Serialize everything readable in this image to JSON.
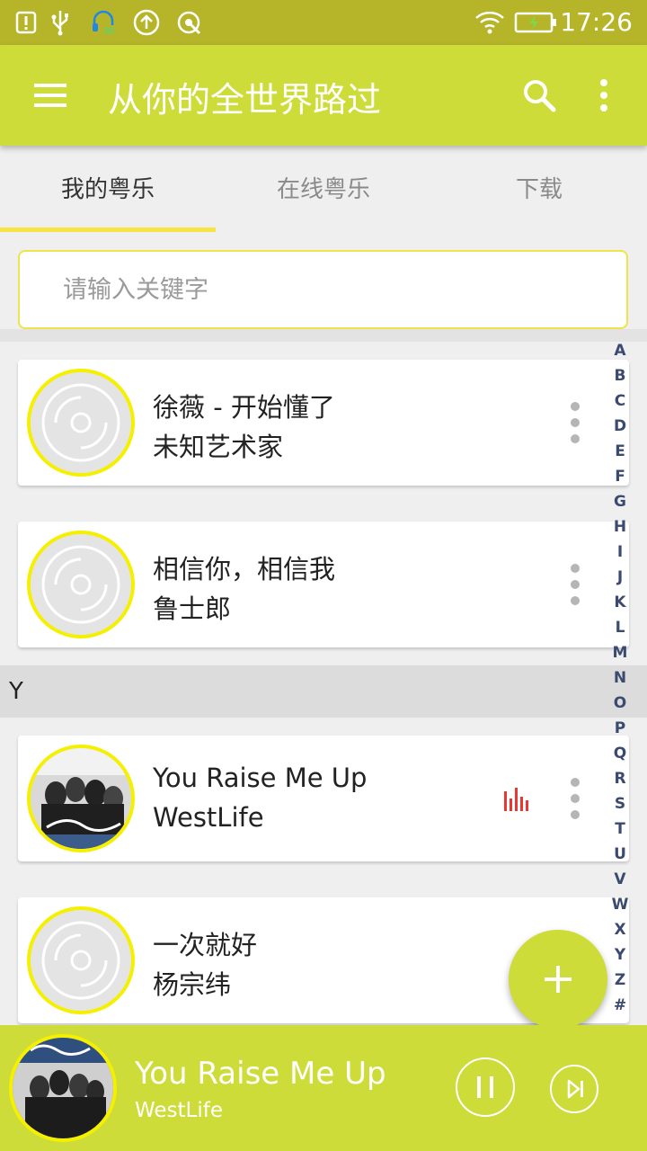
{
  "status_bar": {
    "time": "17:26",
    "icons": [
      "alert-icon",
      "usb-icon",
      "headset-icon",
      "upload-icon",
      "sync-icon",
      "wifi-icon",
      "battery-charging-icon"
    ]
  },
  "toolbar": {
    "title": "从你的全世界路过",
    "menu_icon": "hamburger-icon",
    "search_icon": "search-icon",
    "more_icon": "more-vertical-icon"
  },
  "tabs": [
    {
      "label": "我的粤乐",
      "active": true
    },
    {
      "label": "在线粤乐",
      "active": false
    },
    {
      "label": "下载",
      "active": false
    }
  ],
  "search": {
    "placeholder": "请输入关键字",
    "value": ""
  },
  "songs": [
    {
      "title": "徐薇 - 开始懂了",
      "artist": "未知艺术家",
      "cover": "disc-placeholder",
      "playing": false
    },
    {
      "title": "相信你，相信我",
      "artist": "鲁士郎",
      "cover": "disc-placeholder",
      "playing": false
    },
    {
      "title": "You Raise Me Up",
      "artist": "WestLife",
      "cover": "album-art",
      "playing": true
    },
    {
      "title": "一次就好",
      "artist": "杨宗纬",
      "cover": "disc-placeholder",
      "playing": false
    }
  ],
  "section_header": "Y",
  "index_letters": [
    "A",
    "B",
    "C",
    "D",
    "E",
    "F",
    "G",
    "H",
    "I",
    "J",
    "K",
    "L",
    "M",
    "N",
    "O",
    "P",
    "Q",
    "R",
    "S",
    "T",
    "U",
    "V",
    "W",
    "X",
    "Y",
    "Z",
    "#"
  ],
  "fab": {
    "icon": "plus-icon"
  },
  "player": {
    "title": "You Raise Me Up",
    "artist": "WestLife",
    "pause_icon": "pause-icon",
    "next_icon": "skip-next-icon"
  },
  "colors": {
    "primary": "#cddc39",
    "status_bar": "#b6b429",
    "accent_yellow": "#f5f000",
    "playing_indicator": "#e53935",
    "index_letters": "#3a4a70"
  }
}
